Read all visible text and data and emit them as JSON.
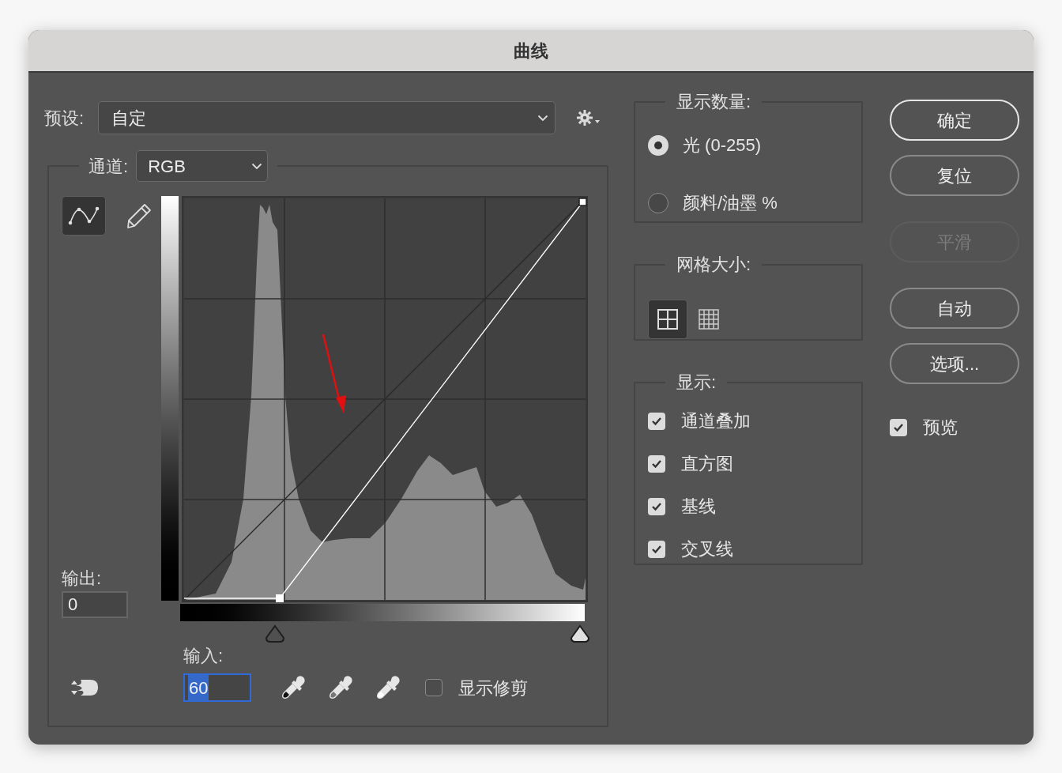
{
  "window": {
    "title": "曲线"
  },
  "preset": {
    "label": "预设:",
    "value": "自定"
  },
  "channel": {
    "label": "通道:",
    "value": "RGB"
  },
  "tools": [
    {
      "kind": "curve",
      "selected": true
    },
    {
      "kind": "pencil",
      "selected": false
    }
  ],
  "output": {
    "label": "输出:",
    "value": "0"
  },
  "input": {
    "label": "输入:",
    "value": "60"
  },
  "show_clipping": {
    "label": "显示修剪",
    "checked": false
  },
  "display_amount": {
    "title": "显示数量:",
    "options": [
      {
        "label": "光 (0-255)",
        "selected": true
      },
      {
        "label": "颜料/油墨 %",
        "selected": false
      }
    ]
  },
  "grid_size": {
    "title": "网格大小:",
    "options": [
      {
        "kind": "simple",
        "selected": true
      },
      {
        "kind": "detailed",
        "selected": false
      }
    ]
  },
  "show": {
    "title": "显示:",
    "options": [
      {
        "label": "通道叠加",
        "checked": true
      },
      {
        "label": "直方图",
        "checked": true
      },
      {
        "label": "基线",
        "checked": true
      },
      {
        "label": "交叉线",
        "checked": true
      }
    ]
  },
  "buttons": [
    {
      "label": "确定",
      "default": true,
      "disabled": false
    },
    {
      "label": "复位",
      "default": false,
      "disabled": false
    },
    {
      "label": "平滑",
      "default": false,
      "disabled": true
    },
    {
      "label": "自动",
      "default": false,
      "disabled": false
    },
    {
      "label": "选项...",
      "default": false,
      "disabled": false
    }
  ],
  "preview": {
    "label": "预览",
    "checked": true
  }
}
